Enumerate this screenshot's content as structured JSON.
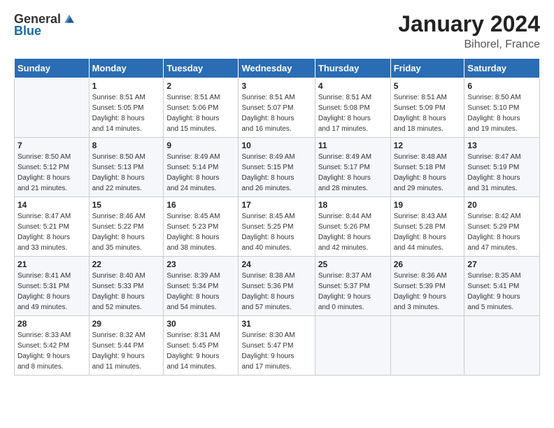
{
  "header": {
    "logo": {
      "general": "General",
      "blue": "Blue"
    },
    "title": "January 2024",
    "subtitle": "Bihorel, France"
  },
  "columns": [
    "Sunday",
    "Monday",
    "Tuesday",
    "Wednesday",
    "Thursday",
    "Friday",
    "Saturday"
  ],
  "weeks": [
    [
      {
        "day": "",
        "sunrise": "",
        "sunset": "",
        "daylight": ""
      },
      {
        "day": "1",
        "sunrise": "Sunrise: 8:51 AM",
        "sunset": "Sunset: 5:05 PM",
        "daylight": "Daylight: 8 hours and 14 minutes."
      },
      {
        "day": "2",
        "sunrise": "Sunrise: 8:51 AM",
        "sunset": "Sunset: 5:06 PM",
        "daylight": "Daylight: 8 hours and 15 minutes."
      },
      {
        "day": "3",
        "sunrise": "Sunrise: 8:51 AM",
        "sunset": "Sunset: 5:07 PM",
        "daylight": "Daylight: 8 hours and 16 minutes."
      },
      {
        "day": "4",
        "sunrise": "Sunrise: 8:51 AM",
        "sunset": "Sunset: 5:08 PM",
        "daylight": "Daylight: 8 hours and 17 minutes."
      },
      {
        "day": "5",
        "sunrise": "Sunrise: 8:51 AM",
        "sunset": "Sunset: 5:09 PM",
        "daylight": "Daylight: 8 hours and 18 minutes."
      },
      {
        "day": "6",
        "sunrise": "Sunrise: 8:50 AM",
        "sunset": "Sunset: 5:10 PM",
        "daylight": "Daylight: 8 hours and 19 minutes."
      }
    ],
    [
      {
        "day": "7",
        "sunrise": "Sunrise: 8:50 AM",
        "sunset": "Sunset: 5:12 PM",
        "daylight": "Daylight: 8 hours and 21 minutes."
      },
      {
        "day": "8",
        "sunrise": "Sunrise: 8:50 AM",
        "sunset": "Sunset: 5:13 PM",
        "daylight": "Daylight: 8 hours and 22 minutes."
      },
      {
        "day": "9",
        "sunrise": "Sunrise: 8:49 AM",
        "sunset": "Sunset: 5:14 PM",
        "daylight": "Daylight: 8 hours and 24 minutes."
      },
      {
        "day": "10",
        "sunrise": "Sunrise: 8:49 AM",
        "sunset": "Sunset: 5:15 PM",
        "daylight": "Daylight: 8 hours and 26 minutes."
      },
      {
        "day": "11",
        "sunrise": "Sunrise: 8:49 AM",
        "sunset": "Sunset: 5:17 PM",
        "daylight": "Daylight: 8 hours and 28 minutes."
      },
      {
        "day": "12",
        "sunrise": "Sunrise: 8:48 AM",
        "sunset": "Sunset: 5:18 PM",
        "daylight": "Daylight: 8 hours and 29 minutes."
      },
      {
        "day": "13",
        "sunrise": "Sunrise: 8:47 AM",
        "sunset": "Sunset: 5:19 PM",
        "daylight": "Daylight: 8 hours and 31 minutes."
      }
    ],
    [
      {
        "day": "14",
        "sunrise": "Sunrise: 8:47 AM",
        "sunset": "Sunset: 5:21 PM",
        "daylight": "Daylight: 8 hours and 33 minutes."
      },
      {
        "day": "15",
        "sunrise": "Sunrise: 8:46 AM",
        "sunset": "Sunset: 5:22 PM",
        "daylight": "Daylight: 8 hours and 35 minutes."
      },
      {
        "day": "16",
        "sunrise": "Sunrise: 8:45 AM",
        "sunset": "Sunset: 5:23 PM",
        "daylight": "Daylight: 8 hours and 38 minutes."
      },
      {
        "day": "17",
        "sunrise": "Sunrise: 8:45 AM",
        "sunset": "Sunset: 5:25 PM",
        "daylight": "Daylight: 8 hours and 40 minutes."
      },
      {
        "day": "18",
        "sunrise": "Sunrise: 8:44 AM",
        "sunset": "Sunset: 5:26 PM",
        "daylight": "Daylight: 8 hours and 42 minutes."
      },
      {
        "day": "19",
        "sunrise": "Sunrise: 8:43 AM",
        "sunset": "Sunset: 5:28 PM",
        "daylight": "Daylight: 8 hours and 44 minutes."
      },
      {
        "day": "20",
        "sunrise": "Sunrise: 8:42 AM",
        "sunset": "Sunset: 5:29 PM",
        "daylight": "Daylight: 8 hours and 47 minutes."
      }
    ],
    [
      {
        "day": "21",
        "sunrise": "Sunrise: 8:41 AM",
        "sunset": "Sunset: 5:31 PM",
        "daylight": "Daylight: 8 hours and 49 minutes."
      },
      {
        "day": "22",
        "sunrise": "Sunrise: 8:40 AM",
        "sunset": "Sunset: 5:33 PM",
        "daylight": "Daylight: 8 hours and 52 minutes."
      },
      {
        "day": "23",
        "sunrise": "Sunrise: 8:39 AM",
        "sunset": "Sunset: 5:34 PM",
        "daylight": "Daylight: 8 hours and 54 minutes."
      },
      {
        "day": "24",
        "sunrise": "Sunrise: 8:38 AM",
        "sunset": "Sunset: 5:36 PM",
        "daylight": "Daylight: 8 hours and 57 minutes."
      },
      {
        "day": "25",
        "sunrise": "Sunrise: 8:37 AM",
        "sunset": "Sunset: 5:37 PM",
        "daylight": "Daylight: 9 hours and 0 minutes."
      },
      {
        "day": "26",
        "sunrise": "Sunrise: 8:36 AM",
        "sunset": "Sunset: 5:39 PM",
        "daylight": "Daylight: 9 hours and 3 minutes."
      },
      {
        "day": "27",
        "sunrise": "Sunrise: 8:35 AM",
        "sunset": "Sunset: 5:41 PM",
        "daylight": "Daylight: 9 hours and 5 minutes."
      }
    ],
    [
      {
        "day": "28",
        "sunrise": "Sunrise: 8:33 AM",
        "sunset": "Sunset: 5:42 PM",
        "daylight": "Daylight: 9 hours and 8 minutes."
      },
      {
        "day": "29",
        "sunrise": "Sunrise: 8:32 AM",
        "sunset": "Sunset: 5:44 PM",
        "daylight": "Daylight: 9 hours and 11 minutes."
      },
      {
        "day": "30",
        "sunrise": "Sunrise: 8:31 AM",
        "sunset": "Sunset: 5:45 PM",
        "daylight": "Daylight: 9 hours and 14 minutes."
      },
      {
        "day": "31",
        "sunrise": "Sunrise: 8:30 AM",
        "sunset": "Sunset: 5:47 PM",
        "daylight": "Daylight: 9 hours and 17 minutes."
      },
      {
        "day": "",
        "sunrise": "",
        "sunset": "",
        "daylight": ""
      },
      {
        "day": "",
        "sunrise": "",
        "sunset": "",
        "daylight": ""
      },
      {
        "day": "",
        "sunrise": "",
        "sunset": "",
        "daylight": ""
      }
    ]
  ]
}
